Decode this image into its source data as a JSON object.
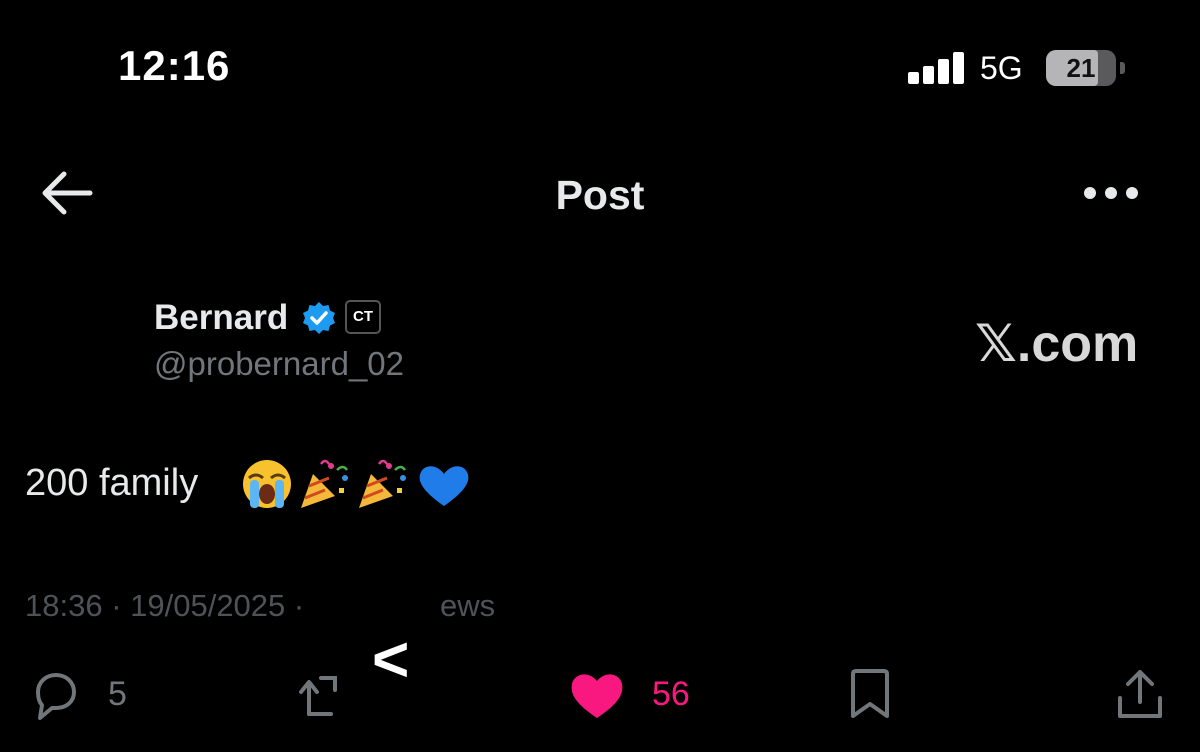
{
  "status_bar": {
    "time": "12:16",
    "network": "5G",
    "battery": "21",
    "battery_level_percent": 21
  },
  "nav": {
    "title": "Post",
    "icons": [
      "arrow-left-icon",
      "more-horizontal-icon"
    ]
  },
  "author": {
    "name": "Bernard",
    "handle": "@probernard_02",
    "verified_color": "#1d9bf0",
    "affiliation_badge": "CT"
  },
  "watermark": "𝕏.com",
  "post": {
    "text": "200 family",
    "emojis": [
      "loudly-crying-face",
      "party-popper",
      "party-popper",
      "blue-heart"
    ]
  },
  "meta": {
    "timestamp": "18:36 · 19/05/2025 ·",
    "views_fragment": "ews",
    "overlay_symbol": "<"
  },
  "actions": {
    "reply_count": "5",
    "like_count": "56",
    "like_color": "#f91880",
    "icons": [
      "reply-icon",
      "retweet-icon",
      "heart-icon",
      "bookmark-icon",
      "share-icon"
    ]
  }
}
